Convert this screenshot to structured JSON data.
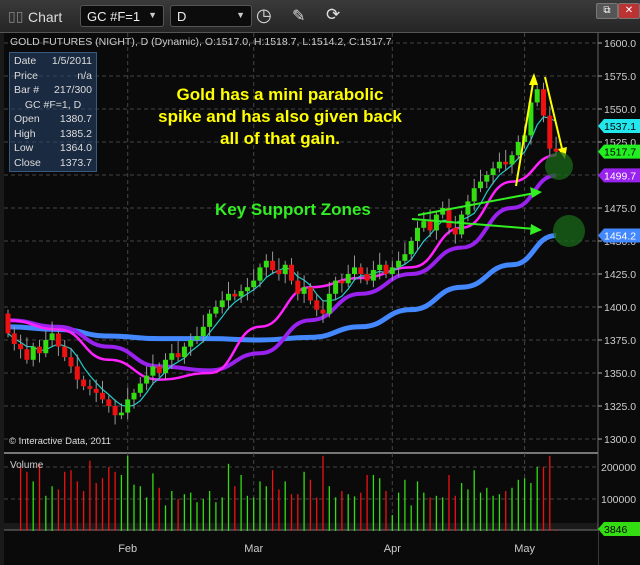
{
  "window": {
    "title": "Chart",
    "symbol": "GC #F=1",
    "interval": "D"
  },
  "chart_header": "GOLD FUTURES (NIGHT), D (Dynamic), O:1517.0, H:1518.7, L:1514.2, C:1517.7",
  "info_panel": {
    "rows": [
      {
        "label": "Date",
        "value": "1/5/2011"
      },
      {
        "label": "Price",
        "value": "n/a"
      },
      {
        "label": "Bar #",
        "value": "217/300"
      }
    ],
    "symbol_line": "GC #F=1, D",
    "ohlc": [
      {
        "label": "Open",
        "value": "1380.7"
      },
      {
        "label": "High",
        "value": "1385.2"
      },
      {
        "label": "Low",
        "value": "1364.0"
      },
      {
        "label": "Close",
        "value": "1373.7"
      }
    ]
  },
  "annotations": {
    "main": "Gold has a mini parabolic spike and has also given back all of that gain.",
    "support": "Key Support Zones"
  },
  "copyright": "© Interactive Data, 2011",
  "volume_label": "Volume",
  "colors": {
    "up": "#33dd11",
    "down": "#ee1111",
    "ma_fast": "#22cccc",
    "ma_mid": "#ff22ff",
    "ma_slow": "#9922ee",
    "ma_long": "#4488ff",
    "annotation": "#ffff00",
    "support": "#33ee22"
  },
  "chart_data": {
    "type": "candlestick",
    "price_ticks": [
      "1600.0",
      "1575.0",
      "1550.0",
      "1525.0",
      "1500.0",
      "1475.0",
      "1450.0",
      "1425.0",
      "1400.0",
      "1375.0",
      "1350.0",
      "1325.0",
      "1300.0"
    ],
    "volume_ticks": [
      "200000",
      "100000"
    ],
    "x_labels": [
      {
        "label": "Feb",
        "bar": 19
      },
      {
        "label": "Mar",
        "bar": 39
      },
      {
        "label": "Apr",
        "bar": 61
      },
      {
        "label": "May",
        "bar": 82
      }
    ],
    "price_markers": [
      {
        "value": "1537.1",
        "color": "#22e8ee"
      },
      {
        "value": "1517.7",
        "color": "#22ee22"
      },
      {
        "value": "1499.7",
        "color": "#9922ee"
      },
      {
        "value": "1454.2",
        "color": "#4488ff"
      }
    ],
    "volume_marker": "3846",
    "closes": [
      1380,
      1372,
      1368,
      1360,
      1370,
      1365,
      1375,
      1380,
      1370,
      1362,
      1355,
      1345,
      1340,
      1338,
      1335,
      1330,
      1325,
      1318,
      1320,
      1330,
      1335,
      1342,
      1348,
      1355,
      1350,
      1360,
      1365,
      1362,
      1370,
      1375,
      1378,
      1385,
      1395,
      1400,
      1405,
      1410,
      1408,
      1412,
      1415,
      1420,
      1430,
      1435,
      1428,
      1425,
      1432,
      1420,
      1410,
      1415,
      1405,
      1398,
      1395,
      1410,
      1420,
      1418,
      1425,
      1430,
      1425,
      1420,
      1428,
      1432,
      1425,
      1430,
      1435,
      1440,
      1450,
      1460,
      1465,
      1458,
      1470,
      1475,
      1460,
      1455,
      1470,
      1480,
      1490,
      1495,
      1500,
      1505,
      1510,
      1508,
      1515,
      1525,
      1530,
      1555,
      1565,
      1545,
      1520,
      1517.7
    ],
    "first_open": 1395,
    "volumes": [
      200000,
      185000,
      155000,
      210000,
      110000,
      140000,
      130000,
      185000,
      190000,
      155000,
      125000,
      220000,
      150000,
      165000,
      200000,
      185000,
      175000,
      235000,
      145000,
      140000,
      105000,
      180000,
      135000,
      80000,
      125000,
      100000,
      115000,
      120000,
      90000,
      100000,
      125000,
      90000,
      105000,
      210000,
      140000,
      175000,
      110000,
      105000,
      155000,
      140000,
      190000,
      130000,
      155000,
      115000,
      115000,
      185000,
      160000,
      105000,
      235000,
      140000,
      105000,
      125000,
      115000,
      108000,
      120000,
      175000,
      175000,
      165000,
      125000,
      50000,
      120000,
      160000,
      80000,
      155000,
      120000,
      105000,
      110000,
      105000,
      175000,
      110000,
      150000,
      130000,
      190000,
      120000,
      135000,
      110000,
      115000,
      125000,
      135000,
      160000,
      165000,
      150000,
      200000,
      200000,
      235000,
      3846
    ],
    "ma_long": [
      1385,
      1383,
      1378,
      1376,
      1376,
      1375,
      1377,
      1385,
      1398,
      1415,
      1432,
      1454.2
    ],
    "ma_slow": [
      1390,
      1385,
      1370,
      1355,
      1352,
      1365,
      1390,
      1410,
      1425,
      1445,
      1475,
      1499.7
    ],
    "ma_mid": [
      1390,
      1383,
      1360,
      1345,
      1350,
      1385,
      1415,
      1422,
      1430,
      1460,
      1495,
      1515
    ]
  }
}
